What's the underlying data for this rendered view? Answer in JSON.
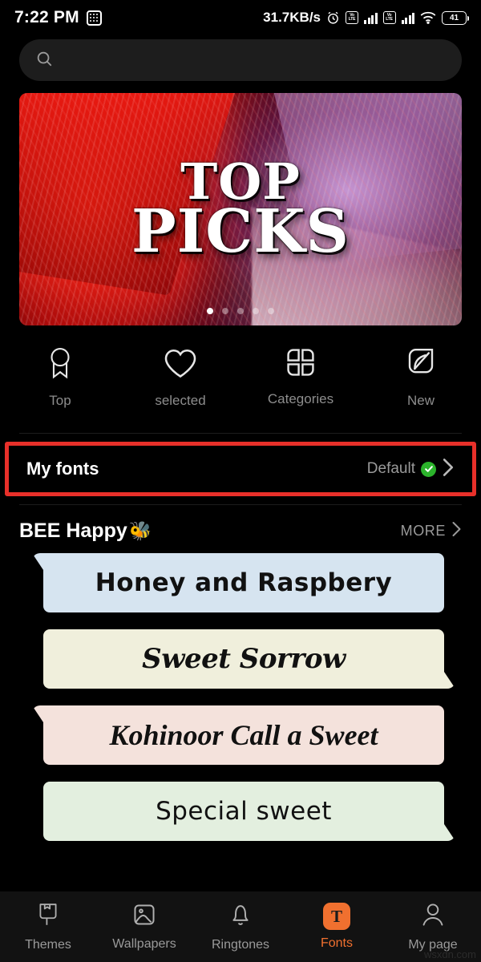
{
  "statusbar": {
    "time": "7:22 PM",
    "app_icon": "app-grid-icon",
    "network_speed": "31.7KB/s",
    "alarm_icon": "alarm-clock-icon",
    "sim1": "VoLTE",
    "sim2": "VoLTE",
    "wifi_icon": "wifi-icon",
    "battery_level": "41"
  },
  "search": {
    "value": "",
    "placeholder": "",
    "icon": "search-icon"
  },
  "banner": {
    "title_line1": "TOP",
    "title_line2": "PICKS",
    "dots_total": 5,
    "dots_active_index": 0
  },
  "quicklinks": [
    {
      "label": "Top",
      "icon": "award-ribbon-icon"
    },
    {
      "label": "selected",
      "icon": "heart-icon"
    },
    {
      "label": "Categories",
      "icon": "grid-petals-icon"
    },
    {
      "label": "New",
      "icon": "leaf-icon"
    }
  ],
  "my_fonts": {
    "title": "My fonts",
    "value": "Default",
    "badge_icon": "green-check-icon",
    "chevron_icon": "chevron-right-icon",
    "highlight_color": "#e8302a"
  },
  "section": {
    "title": "BEE Happy",
    "emoji": "🐝",
    "more_label": "MORE",
    "more_icon": "chevron-right-icon"
  },
  "font_cards": [
    {
      "text": "Honey and Raspbery",
      "bg": "#d6e4f0",
      "style": "f-rounded",
      "tail": "tail-left"
    },
    {
      "text": "Sweet Sorrow",
      "bg": "#f0efdc",
      "style": "f-script",
      "tail": "tail-right"
    },
    {
      "text": "Kohinoor  Call a Sweet",
      "bg": "#f4e2dc",
      "style": "f-serif",
      "tail": "tail-left"
    },
    {
      "text": "Special sweet",
      "bg": "#e3efdf",
      "style": "f-thin",
      "tail": "tail-right"
    }
  ],
  "bottomnav": {
    "active_color": "#f0702f",
    "items": [
      {
        "label": "Themes",
        "icon": "theme-brush-icon",
        "active": false
      },
      {
        "label": "Wallpapers",
        "icon": "image-icon",
        "active": false
      },
      {
        "label": "Ringtones",
        "icon": "bell-icon",
        "active": false
      },
      {
        "label": "Fonts",
        "icon": "fonts-t-icon",
        "active": true,
        "badge": "T"
      },
      {
        "label": "My page",
        "icon": "person-icon",
        "active": false
      }
    ]
  },
  "watermark": "wsxdn.com"
}
